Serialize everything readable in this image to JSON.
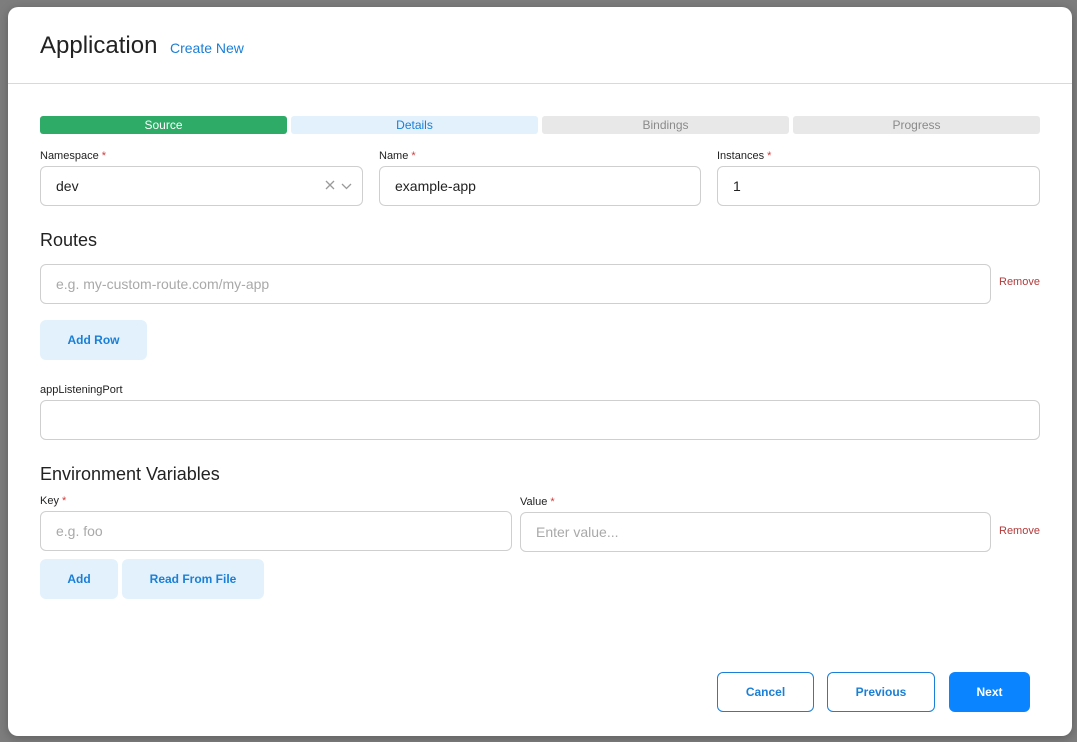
{
  "modal": {
    "title": "Application",
    "create_new": "Create New"
  },
  "steps": [
    {
      "label": "Source",
      "state": "done"
    },
    {
      "label": "Details",
      "state": "active"
    },
    {
      "label": "Bindings",
      "state": "todo"
    },
    {
      "label": "Progress",
      "state": "todo"
    }
  ],
  "fields": {
    "namespace": {
      "label": "Namespace",
      "required": "*",
      "value": "dev"
    },
    "name": {
      "label": "Name",
      "required": "*",
      "value": "example-app"
    },
    "instances": {
      "label": "Instances",
      "required": "*",
      "value": "1"
    }
  },
  "routes": {
    "title": "Routes",
    "placeholder": "e.g. my-custom-route.com/my-app",
    "remove": "Remove",
    "add_row": "Add Row"
  },
  "app_listening_port": {
    "label": "appListeningPort",
    "value": ""
  },
  "env": {
    "title": "Environment Variables",
    "key_label": "Key",
    "key_required": "*",
    "key_placeholder": "e.g. foo",
    "value_label": "Value",
    "value_required": "*",
    "value_placeholder": "Enter value...",
    "remove": "Remove",
    "add": "Add",
    "read_from_file": "Read From File"
  },
  "footer": {
    "cancel": "Cancel",
    "previous": "Previous",
    "next": "Next"
  },
  "icons": {
    "clear": "close-icon",
    "dropdown": "chevron-down-icon"
  },
  "colors": {
    "accent": "#1a7fd6",
    "primary": "#0a84ff",
    "success": "#2eab67",
    "danger": "#b23a3a"
  }
}
